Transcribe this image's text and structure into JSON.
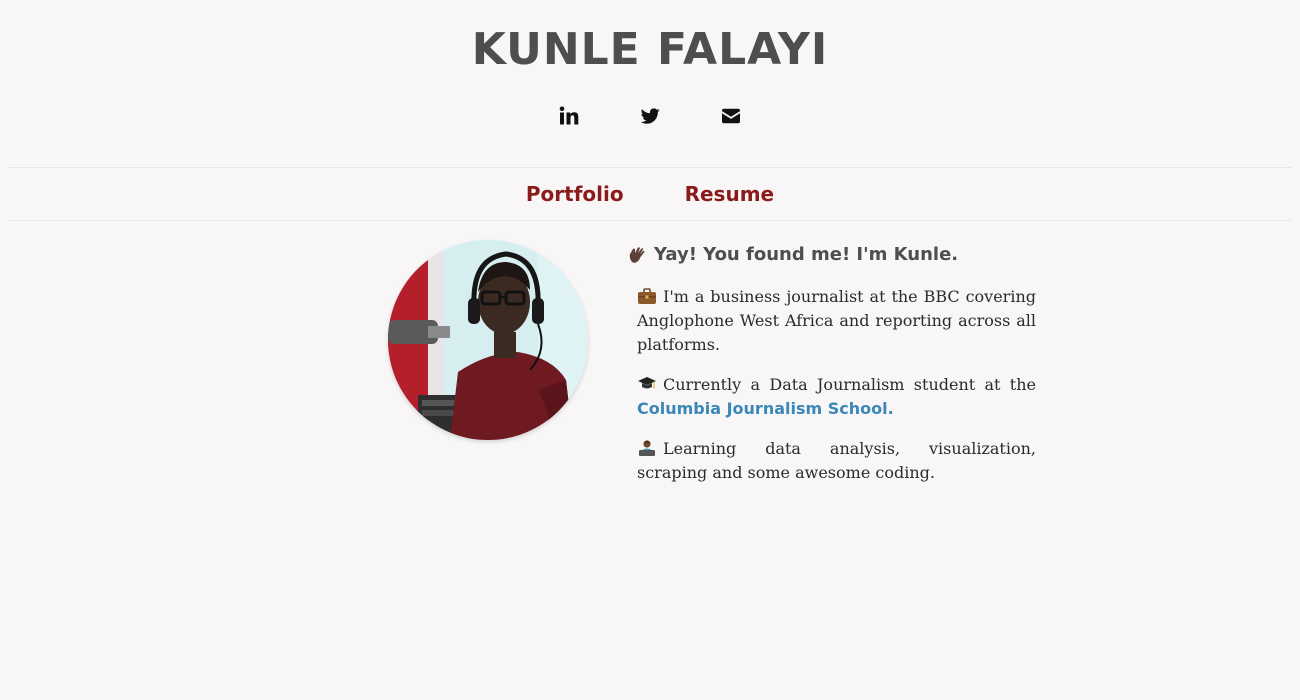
{
  "header": {
    "title": "KUNLE FALAYI"
  },
  "social": [
    {
      "name": "linkedin",
      "icon": "linkedin-icon"
    },
    {
      "name": "twitter",
      "icon": "twitter-icon"
    },
    {
      "name": "email",
      "icon": "envelope-icon"
    }
  ],
  "nav": {
    "portfolio_label": "Portfolio",
    "resume_label": "Resume"
  },
  "profile": {
    "photo_alt": "Kunle Falayi"
  },
  "intro": {
    "greeting_emoji": "waving-hand-icon",
    "greeting": "Yay! You found me! I'm Kunle.",
    "job_emoji": "briefcase-icon",
    "job_text": "I'm a business journalist at the BBC covering Anglophone West Africa and reporting across all platforms.",
    "study_emoji": "graduation-cap-icon",
    "study_text": "Currently a Data Journalism student at the",
    "school_link": "Columbia Journalism School.",
    "learning_emoji": "technologist-icon",
    "learning_text": "Learning data analysis, visualization, scraping and some awesome coding."
  },
  "colors": {
    "background": "#f8f6f7",
    "title": "#4e4e4e",
    "nav_link": "#8b1b1b",
    "body_link": "#3a87b8",
    "body_text": "#2b2b2b"
  }
}
